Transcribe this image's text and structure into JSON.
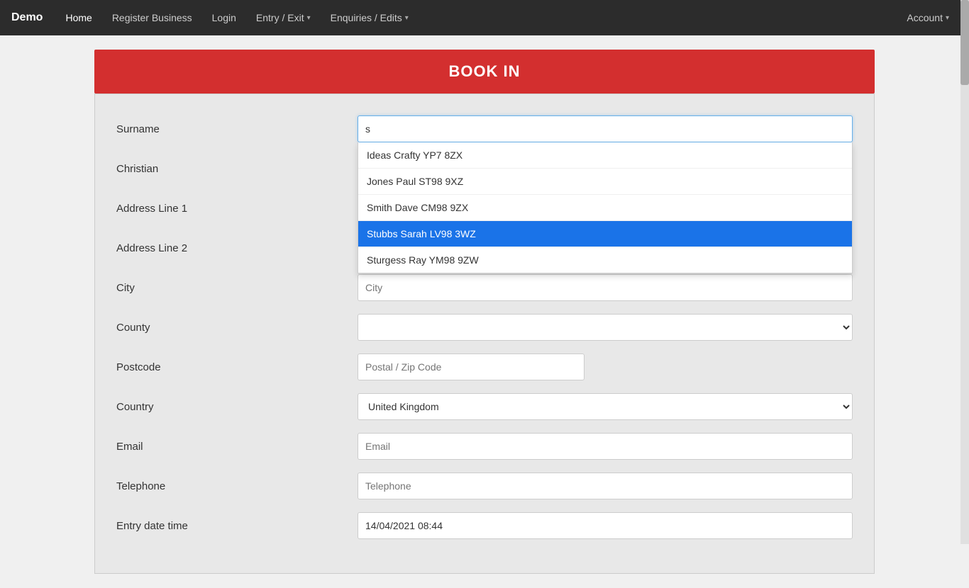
{
  "app": {
    "brand": "Demo",
    "nav": {
      "home": "Home",
      "register_business": "Register Business",
      "login": "Login",
      "entry_exit": "Entry / Exit",
      "enquiries_edits": "Enquiries / Edits",
      "account": "Account"
    }
  },
  "page": {
    "title": "BOOK IN"
  },
  "form": {
    "surname_label": "Surname",
    "surname_value": "s",
    "christian_label": "Christian",
    "address1_label": "Address Line 1",
    "address2_label": "Address Line 2",
    "city_label": "City",
    "city_placeholder": "City",
    "county_label": "County",
    "postcode_label": "Postcode",
    "postcode_placeholder": "Postal / Zip Code",
    "country_label": "Country",
    "country_value": "United Kingdom",
    "email_label": "Email",
    "email_placeholder": "Email",
    "telephone_label": "Telephone",
    "telephone_placeholder": "Telephone",
    "entry_date_label": "Entry date time",
    "entry_date_value": "14/04/2021 08:44"
  },
  "autocomplete": {
    "items": [
      {
        "label": "Ideas Crafty YP7 8ZX",
        "selected": false
      },
      {
        "label": "Jones Paul ST98 9XZ",
        "selected": false
      },
      {
        "label": "Smith Dave CM98 9ZX",
        "selected": false
      },
      {
        "label": "Stubbs Sarah LV98 3WZ",
        "selected": true
      },
      {
        "label": "Sturgess Ray YM98 9ZW",
        "selected": false
      }
    ]
  }
}
